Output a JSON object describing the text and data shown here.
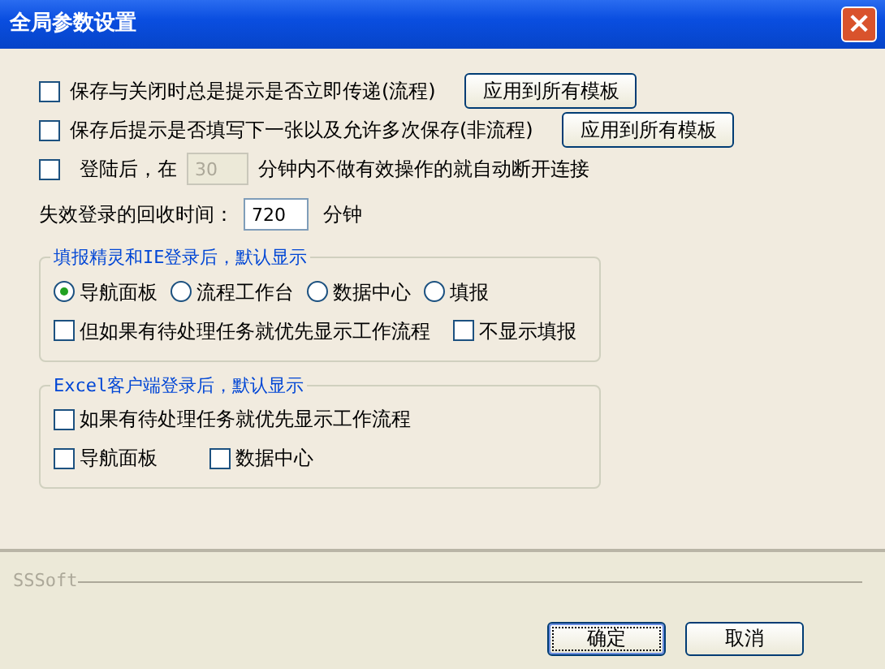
{
  "window": {
    "title": "全局参数设置",
    "close": "×"
  },
  "options": [
    {
      "kind": "apply",
      "label": "保存与关闭时总是提示是否立即传递(流程)",
      "checked": false,
      "button": "应用到所有模板"
    },
    {
      "kind": "apply",
      "label": "保存后提示是否填写下一张以及允许多次保存(非流程)",
      "checked": false,
      "button": "应用到所有模板"
    },
    {
      "kind": "timeout",
      "label": "登陆后，在",
      "checked": false,
      "value": "30",
      "disabled": true,
      "unit": "分钟内不做有效操作的就自动断开连接"
    }
  ],
  "recycle": {
    "label": "失效登录的回收时间：",
    "value": "720",
    "unit": "分钟"
  },
  "groups": [
    {
      "title": "填报精灵和IE登录后，默认显示",
      "rows": [
        {
          "options": [
            {
              "kind": "radio",
              "label": "导航面板",
              "selected": true
            },
            {
              "kind": "radio",
              "label": "流程工作台",
              "selected": false
            },
            {
              "kind": "radio",
              "label": "数据中心",
              "selected": false
            },
            {
              "kind": "radio",
              "label": "填报",
              "selected": false
            }
          ]
        },
        {
          "options": [
            {
              "kind": "checkbox",
              "label": "但如果有待处理任务就优先显示工作流程",
              "checked": false
            },
            {
              "kind": "checkbox",
              "label": "不显示填报",
              "checked": false
            }
          ]
        }
      ]
    },
    {
      "title": "Excel客户端登录后，默认显示",
      "rows": [
        {
          "options": [
            {
              "kind": "checkbox",
              "label": "如果有待处理任务就优先显示工作流程",
              "checked": false
            }
          ]
        },
        {
          "options": [
            {
              "kind": "checkbox",
              "label": "导航面板",
              "checked": false
            },
            {
              "kind": "checkbox",
              "label": "数据中心",
              "checked": false
            }
          ]
        }
      ]
    }
  ],
  "brand": "SSSoft",
  "buttons": [
    {
      "label": "确定",
      "default": true
    },
    {
      "label": "取消",
      "default": false
    }
  ]
}
